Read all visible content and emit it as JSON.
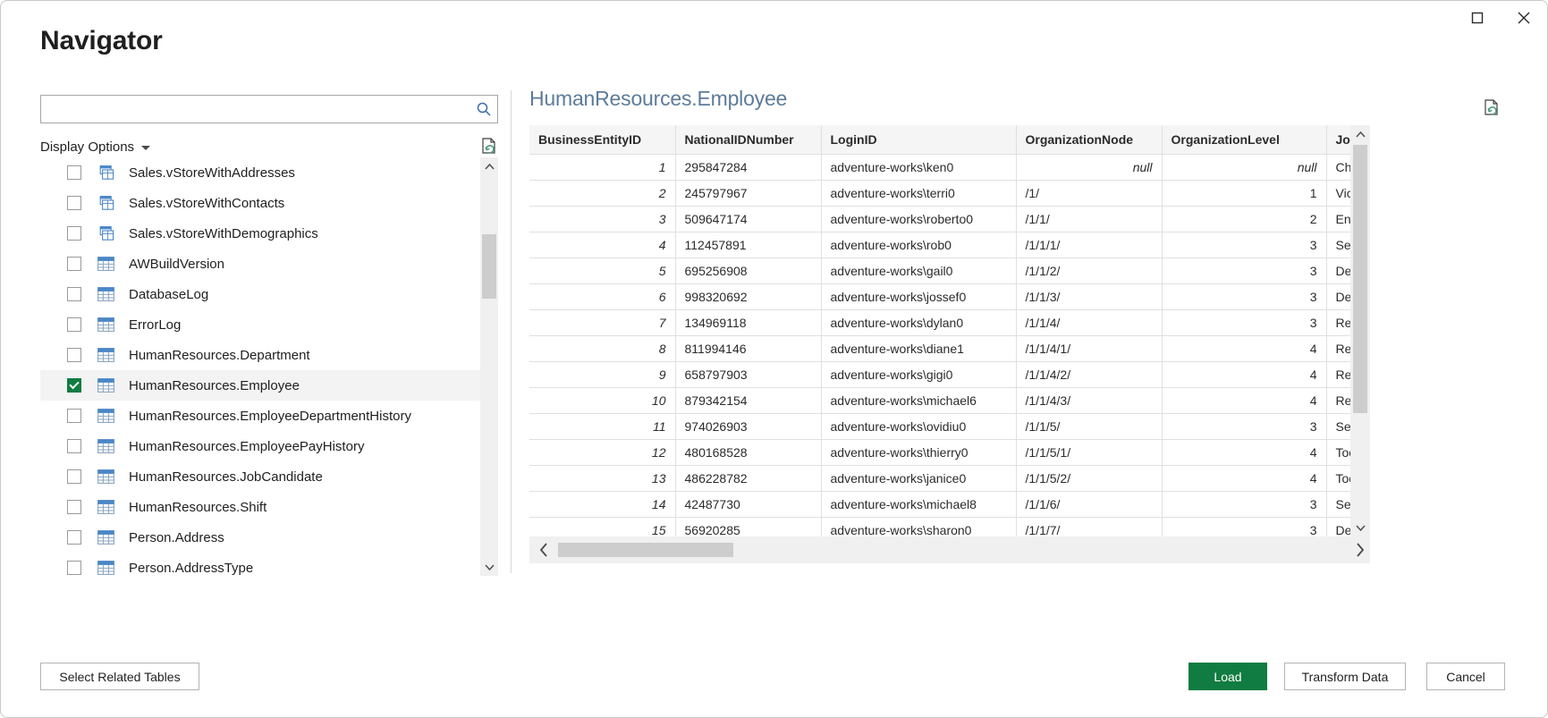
{
  "window": {
    "title": "Navigator",
    "maximize_icon": "maximize-icon",
    "close_icon": "close-icon"
  },
  "search": {
    "value": "",
    "placeholder": "",
    "icon": "search-icon"
  },
  "left_panel": {
    "display_options_label": "Display Options",
    "caret_icon": "chevron-down-icon",
    "refresh_icon": "refresh-preview-icon",
    "items": [
      {
        "label": "Sales.vStoreWithAddresses",
        "icon": "view-icon",
        "checked": false,
        "selected": false
      },
      {
        "label": "Sales.vStoreWithContacts",
        "icon": "view-icon",
        "checked": false,
        "selected": false
      },
      {
        "label": "Sales.vStoreWithDemographics",
        "icon": "view-icon",
        "checked": false,
        "selected": false
      },
      {
        "label": "AWBuildVersion",
        "icon": "table-icon",
        "checked": false,
        "selected": false
      },
      {
        "label": "DatabaseLog",
        "icon": "table-icon",
        "checked": false,
        "selected": false
      },
      {
        "label": "ErrorLog",
        "icon": "table-icon",
        "checked": false,
        "selected": false
      },
      {
        "label": "HumanResources.Department",
        "icon": "table-icon",
        "checked": false,
        "selected": false
      },
      {
        "label": "HumanResources.Employee",
        "icon": "table-icon",
        "checked": true,
        "selected": true
      },
      {
        "label": "HumanResources.EmployeeDepartmentHistory",
        "icon": "table-icon",
        "checked": false,
        "selected": false
      },
      {
        "label": "HumanResources.EmployeePayHistory",
        "icon": "table-icon",
        "checked": false,
        "selected": false
      },
      {
        "label": "HumanResources.JobCandidate",
        "icon": "table-icon",
        "checked": false,
        "selected": false
      },
      {
        "label": "HumanResources.Shift",
        "icon": "table-icon",
        "checked": false,
        "selected": false
      },
      {
        "label": "Person.Address",
        "icon": "table-icon",
        "checked": false,
        "selected": false
      },
      {
        "label": "Person.AddressType",
        "icon": "table-icon",
        "checked": false,
        "selected": false
      }
    ]
  },
  "preview": {
    "title": "HumanResources.Employee",
    "refresh_icon": "refresh-preview-icon",
    "columns": [
      "BusinessEntityID",
      "NationalIDNumber",
      "LoginID",
      "OrganizationNode",
      "OrganizationLevel",
      "JobTitle"
    ],
    "rows": [
      {
        "BusinessEntityID": "1",
        "NationalIDNumber": "295847284",
        "LoginID": "adventure-works\\ken0",
        "OrganizationNode": "null",
        "OrganizationLevel": "null",
        "JobTitle": "Chief"
      },
      {
        "BusinessEntityID": "2",
        "NationalIDNumber": "245797967",
        "LoginID": "adventure-works\\terri0",
        "OrganizationNode": "/1/",
        "OrganizationLevel": "1",
        "JobTitle": "Vice P"
      },
      {
        "BusinessEntityID": "3",
        "NationalIDNumber": "509647174",
        "LoginID": "adventure-works\\roberto0",
        "OrganizationNode": "/1/1/",
        "OrganizationLevel": "2",
        "JobTitle": "Engin"
      },
      {
        "BusinessEntityID": "4",
        "NationalIDNumber": "112457891",
        "LoginID": "adventure-works\\rob0",
        "OrganizationNode": "/1/1/1/",
        "OrganizationLevel": "3",
        "JobTitle": "Senio"
      },
      {
        "BusinessEntityID": "5",
        "NationalIDNumber": "695256908",
        "LoginID": "adventure-works\\gail0",
        "OrganizationNode": "/1/1/2/",
        "OrganizationLevel": "3",
        "JobTitle": "Desig"
      },
      {
        "BusinessEntityID": "6",
        "NationalIDNumber": "998320692",
        "LoginID": "adventure-works\\jossef0",
        "OrganizationNode": "/1/1/3/",
        "OrganizationLevel": "3",
        "JobTitle": "Desig"
      },
      {
        "BusinessEntityID": "7",
        "NationalIDNumber": "134969118",
        "LoginID": "adventure-works\\dylan0",
        "OrganizationNode": "/1/1/4/",
        "OrganizationLevel": "3",
        "JobTitle": "Resea"
      },
      {
        "BusinessEntityID": "8",
        "NationalIDNumber": "811994146",
        "LoginID": "adventure-works\\diane1",
        "OrganizationNode": "/1/1/4/1/",
        "OrganizationLevel": "4",
        "JobTitle": "Resea"
      },
      {
        "BusinessEntityID": "9",
        "NationalIDNumber": "658797903",
        "LoginID": "adventure-works\\gigi0",
        "OrganizationNode": "/1/1/4/2/",
        "OrganizationLevel": "4",
        "JobTitle": "Resea"
      },
      {
        "BusinessEntityID": "10",
        "NationalIDNumber": "879342154",
        "LoginID": "adventure-works\\michael6",
        "OrganizationNode": "/1/1/4/3/",
        "OrganizationLevel": "4",
        "JobTitle": "Resea"
      },
      {
        "BusinessEntityID": "11",
        "NationalIDNumber": "974026903",
        "LoginID": "adventure-works\\ovidiu0",
        "OrganizationNode": "/1/1/5/",
        "OrganizationLevel": "3",
        "JobTitle": "Senio"
      },
      {
        "BusinessEntityID": "12",
        "NationalIDNumber": "480168528",
        "LoginID": "adventure-works\\thierry0",
        "OrganizationNode": "/1/1/5/1/",
        "OrganizationLevel": "4",
        "JobTitle": "Tool D"
      },
      {
        "BusinessEntityID": "13",
        "NationalIDNumber": "486228782",
        "LoginID": "adventure-works\\janice0",
        "OrganizationNode": "/1/1/5/2/",
        "OrganizationLevel": "4",
        "JobTitle": "Tool D"
      },
      {
        "BusinessEntityID": "14",
        "NationalIDNumber": "42487730",
        "LoginID": "adventure-works\\michael8",
        "OrganizationNode": "/1/1/6/",
        "OrganizationLevel": "3",
        "JobTitle": "Senio"
      },
      {
        "BusinessEntityID": "15",
        "NationalIDNumber": "56920285",
        "LoginID": "adventure-works\\sharon0",
        "OrganizationNode": "/1/1/7/",
        "OrganizationLevel": "3",
        "JobTitle": "Desig"
      }
    ]
  },
  "footer": {
    "select_related_label": "Select Related Tables",
    "load_label": "Load",
    "transform_label": "Transform Data",
    "cancel_label": "Cancel"
  },
  "colors": {
    "primary_green": "#107c41",
    "preview_title": "#5d7b99",
    "icon_blue": "#4a87c8",
    "refresh_green": "#4f9c7f"
  }
}
